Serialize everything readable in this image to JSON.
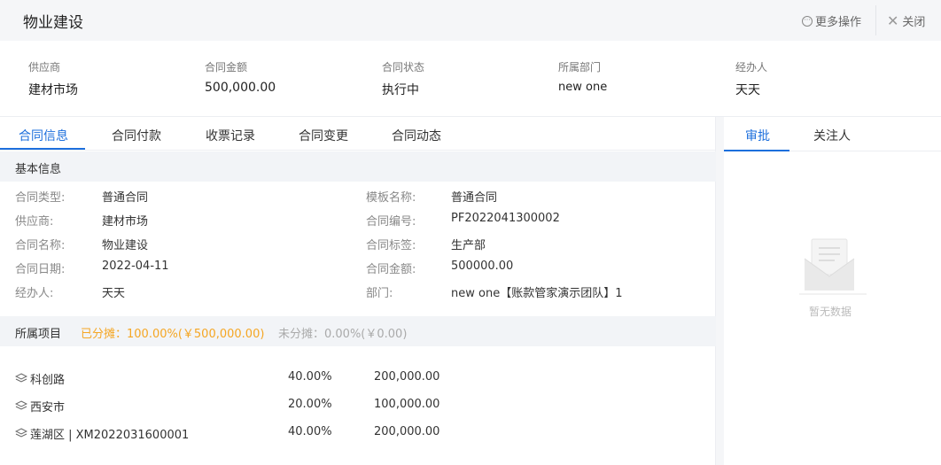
{
  "header": {
    "title": "物业建设",
    "more_label": "更多操作",
    "more_icon": "more-circle-icon",
    "close_label": "关闭",
    "close_icon": "close-icon"
  },
  "summary": [
    {
      "label": "供应商",
      "value": "建材市场"
    },
    {
      "label": "合同金额",
      "value": "500,000.00"
    },
    {
      "label": "合同状态",
      "value": "执行中"
    },
    {
      "label": "所属部门",
      "value": "new one"
    },
    {
      "label": "经办人",
      "value": "天天"
    }
  ],
  "tabs": [
    "合同信息",
    "合同付款",
    "收票记录",
    "合同变更",
    "合同动态"
  ],
  "active_tab": "合同信息",
  "basic_info": {
    "section_title": "基本信息",
    "left_fields": [
      {
        "label": "合同类型:",
        "value": "普通合同"
      },
      {
        "label": "供应商:",
        "value": "建材市场"
      },
      {
        "label": "合同名称:",
        "value": "物业建设"
      },
      {
        "label": "合同日期:",
        "value": "2022-04-11"
      },
      {
        "label": "经办人:",
        "value": "天天"
      }
    ],
    "right_fields": [
      {
        "label": "模板名称:",
        "value": "普通合同"
      },
      {
        "label": "合同编号:",
        "value": "PF2022041300002"
      },
      {
        "label": "合同标签:",
        "value": "生产部"
      },
      {
        "label": "合同金额:",
        "value": "500000.00"
      },
      {
        "label": "部门:",
        "value": "new one【账款管家演示团队】1"
      }
    ]
  },
  "projects": {
    "section_title": "所属项目",
    "allocated": "已分摊：100.00%(￥500,000.00)",
    "unallocated": "未分摊：0.00%(￥0.00)",
    "rows": [
      {
        "name": "科创路",
        "percent": "40.00%",
        "amount": "200,000.00"
      },
      {
        "name": "西安市",
        "percent": "20.00%",
        "amount": "100,000.00"
      },
      {
        "name": "莲湖区 | XM2022031600001",
        "percent": "40.00%",
        "amount": "200,000.00"
      }
    ],
    "row_icon": "layers-icon"
  },
  "right_panel": {
    "tabs": [
      "审批",
      "关注人"
    ],
    "active_tab": "审批",
    "empty_text": "暂无数据",
    "empty_icon": "empty-inbox-icon"
  },
  "colors": {
    "accent": "#1d6fdc",
    "allocated": "#f5a623",
    "header_bg": "#f5f6f8"
  }
}
